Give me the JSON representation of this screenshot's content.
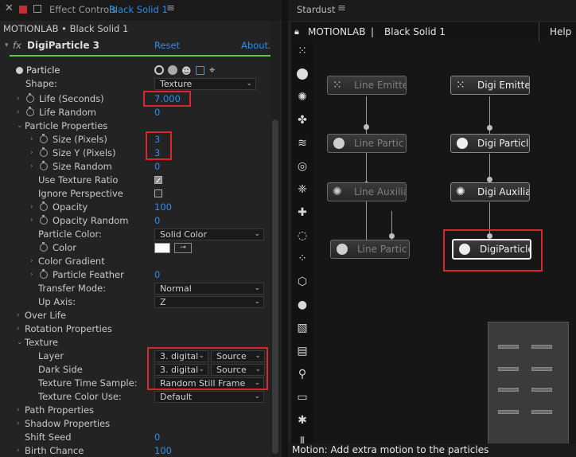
{
  "effect_controls": {
    "tab_title": "Effect Controls",
    "tab_layer": "Black Solid 1",
    "breadcrumb": "MOTIONLAB • Black Solid 1",
    "effect_name": "DigiParticle 3",
    "reset_label": "Reset",
    "about_label": "About..."
  },
  "props": {
    "particle": "Particle",
    "shape_label": "Shape:",
    "shape_value": "Texture",
    "life_label": "Life (Seconds)",
    "life_value": "7.000",
    "life_random_label": "Life Random",
    "life_random_value": "0",
    "particle_properties": "Particle Properties",
    "size_x_label": "Size (Pixels)",
    "size_x_value": "3",
    "size_y_label": "Size Y (Pixels)",
    "size_y_value": "3",
    "size_random_label": "Size Random",
    "size_random_value": "0",
    "use_texture_ratio": "Use Texture Ratio",
    "ignore_perspective": "Ignore Perspective",
    "opacity_label": "Opacity",
    "opacity_value": "100",
    "opacity_random_label": "Opacity Random",
    "opacity_random_value": "0",
    "particle_color_label": "Particle Color:",
    "particle_color_value": "Solid Color",
    "color_label": "Color",
    "color_gradient": "Color Gradient",
    "particle_feather_label": "Particle Feather",
    "particle_feather_value": "0",
    "transfer_mode_label": "Transfer Mode:",
    "transfer_mode_value": "Normal",
    "up_axis_label": "Up Axis:",
    "up_axis_value": "Z",
    "over_life": "Over Life",
    "rotation_properties": "Rotation Properties",
    "texture": "Texture",
    "layer_label": "Layer",
    "layer_value": "3. digital",
    "layer_source": "Source",
    "dark_side_label": "Dark Side",
    "dark_side_value": "3. digital",
    "dark_side_source": "Source",
    "texture_time_label": "Texture Time Sample:",
    "texture_time_value": "Random Still Frame",
    "texture_color_label": "Texture Color Use:",
    "texture_color_value": "Default",
    "path_properties": "Path Properties",
    "shadow_properties": "Shadow Properties",
    "shift_seed_label": "Shift Seed",
    "shift_seed_value": "0",
    "birth_chance_label": "Birth Chance",
    "birth_chance_value": "100"
  },
  "stardust": {
    "tab_title": "Stardust",
    "project": "MOTIONLAB",
    "separator": "|",
    "layer": "Black Solid 1",
    "help": "Help",
    "nodes": {
      "line_emitter": "Line Emitte",
      "line_particle": "Line Partic",
      "line_auxiliary": "Line Auxilia",
      "line_particle_2": "Line Partic",
      "digi_emitter": "Digi Emitte",
      "digi_particle": "Digi Particl",
      "digi_auxiliary": "Digi Auxilia",
      "digi_particle_3": "DigiParticle"
    },
    "status": "Motion: Add extra motion to the particles"
  },
  "colors": {
    "accent_blue": "#2d8ceb",
    "highlight_red": "#d9262f",
    "green_bar": "#5ec846",
    "swatch": "#ffffff"
  }
}
